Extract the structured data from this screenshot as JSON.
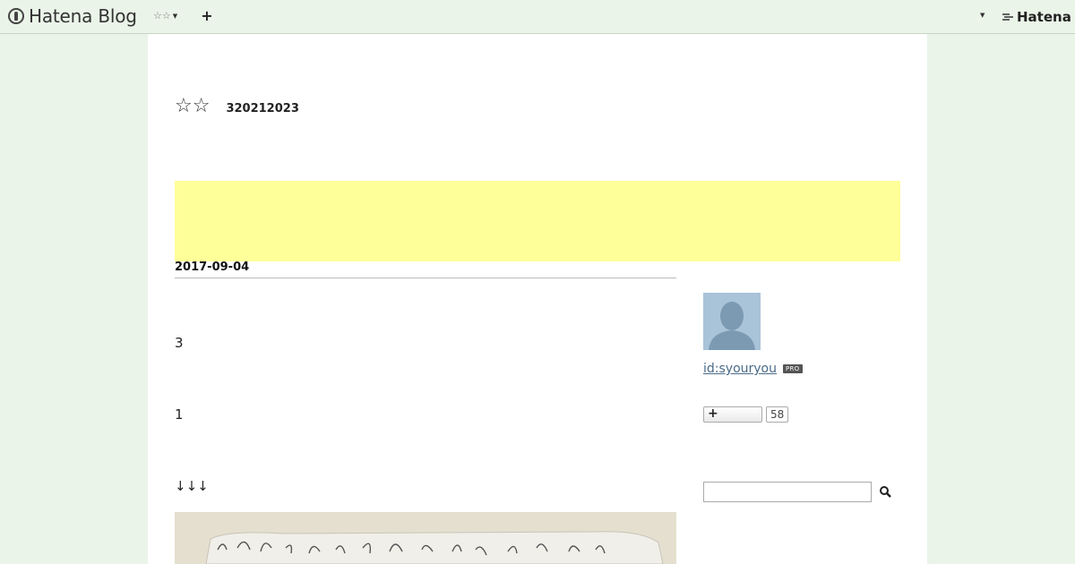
{
  "topbar": {
    "logo_text": "Hatena Blog",
    "blog_menu_label": "☆☆",
    "add_label": "+",
    "brand_text": "Hatena"
  },
  "blog": {
    "title": "☆☆",
    "description": "320212023"
  },
  "entry": {
    "date": "2017-09-04",
    "paragraphs": [
      "3",
      "1",
      "↓↓↓"
    ]
  },
  "sidebar": {
    "user_id": "id:syouryou",
    "pro_badge": "PRO",
    "subscribe_label": "+",
    "subscriber_count": "58",
    "search_placeholder": ""
  },
  "colors": {
    "background": "#eaf4e8",
    "banner": "#ffff99",
    "link": "#4a6b88"
  }
}
